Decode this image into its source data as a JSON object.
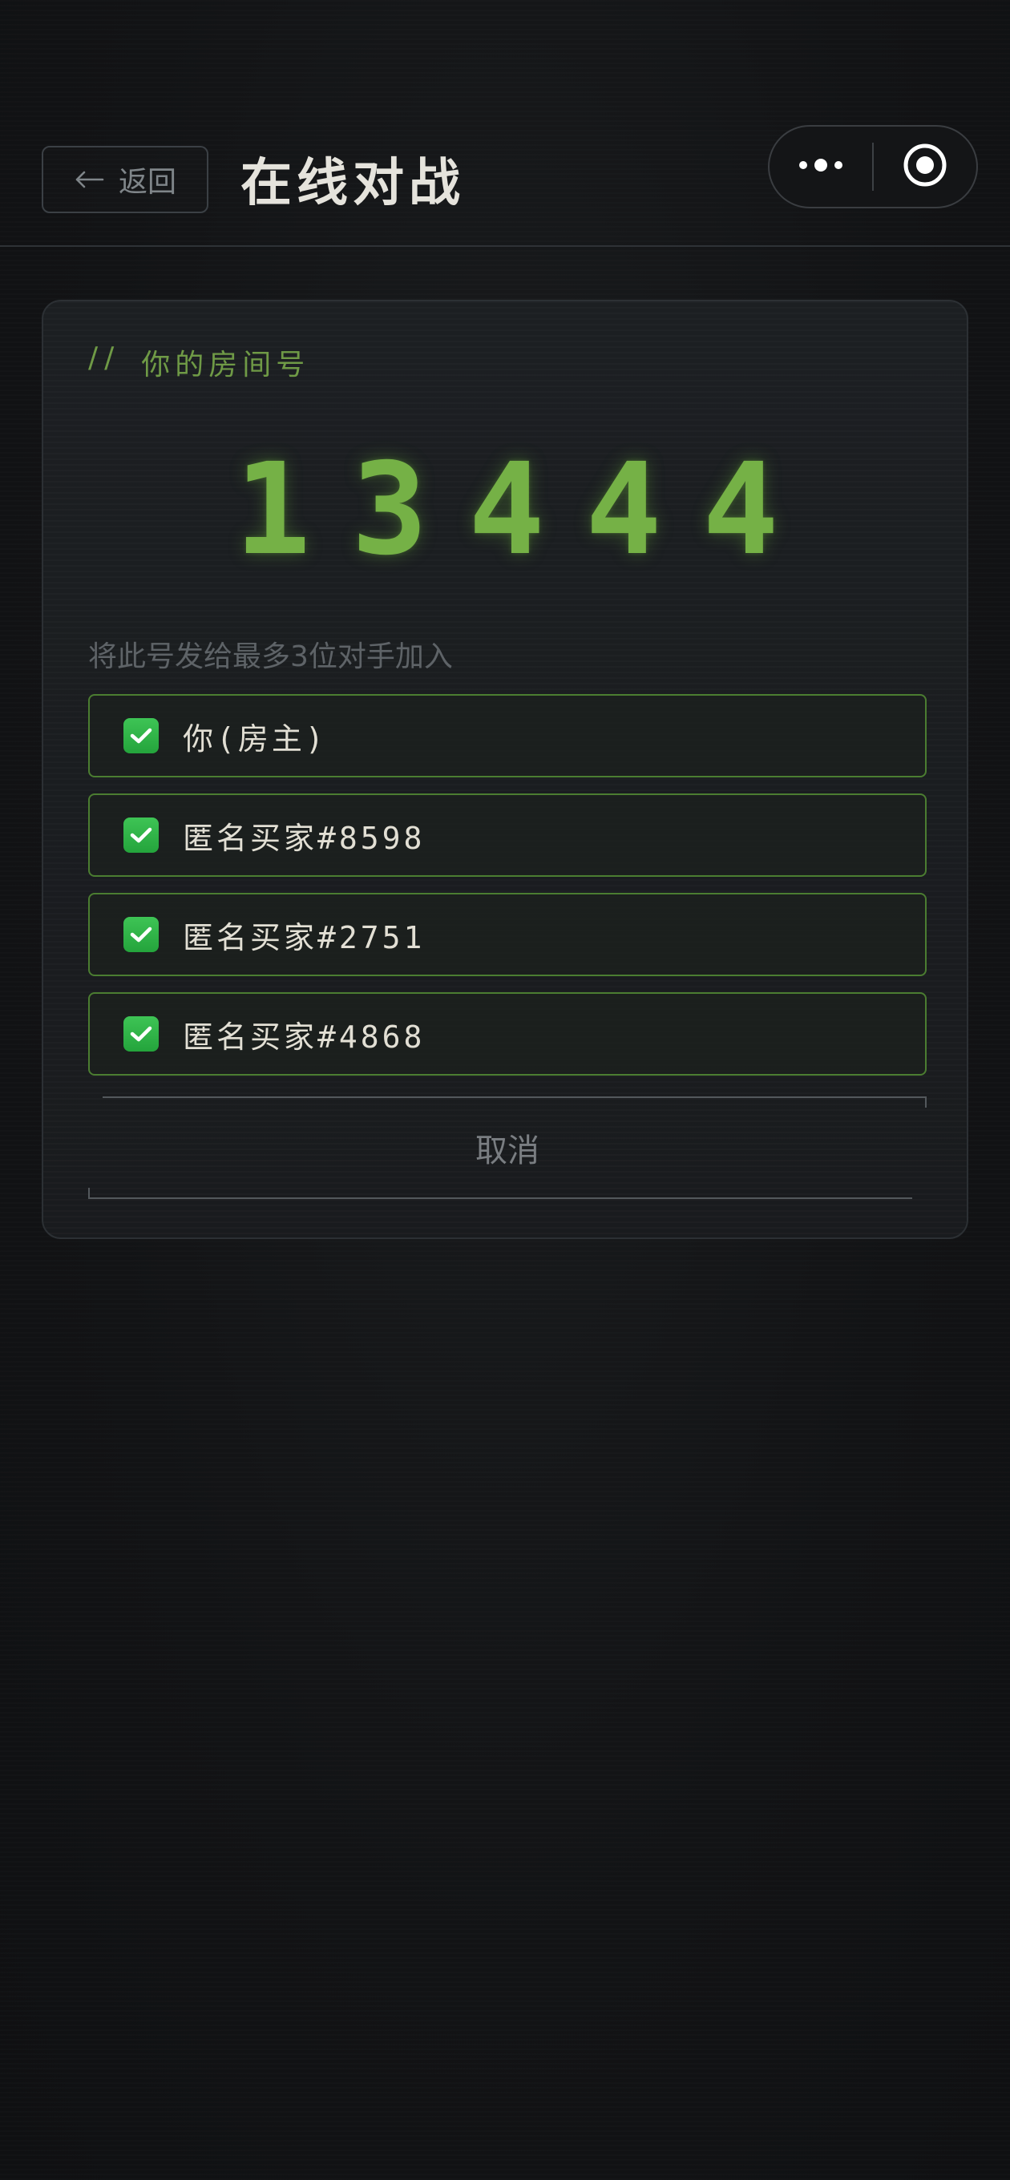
{
  "header": {
    "back_label": "返回",
    "title": "在线对战",
    "back_icon": "arrow-left-icon",
    "menu_icon": "more-dots-icon",
    "close_icon": "target-circle-icon"
  },
  "room": {
    "label_prefix": "//",
    "label": "你的房间号",
    "digits": [
      "1",
      "3",
      "4",
      "4",
      "4"
    ],
    "hint": "将此号发给最多3位对手加入",
    "players": [
      {
        "name": "你(房主)",
        "checked": true
      },
      {
        "name": "匿名买家#8598",
        "checked": true
      },
      {
        "name": "匿名买家#2751",
        "checked": true
      },
      {
        "name": "匿名买家#4868",
        "checked": true
      }
    ],
    "cancel_label": "取消"
  },
  "colors": {
    "accent_green": "#75b146",
    "checkbox_green": "#2fb548",
    "background": "#121315"
  }
}
